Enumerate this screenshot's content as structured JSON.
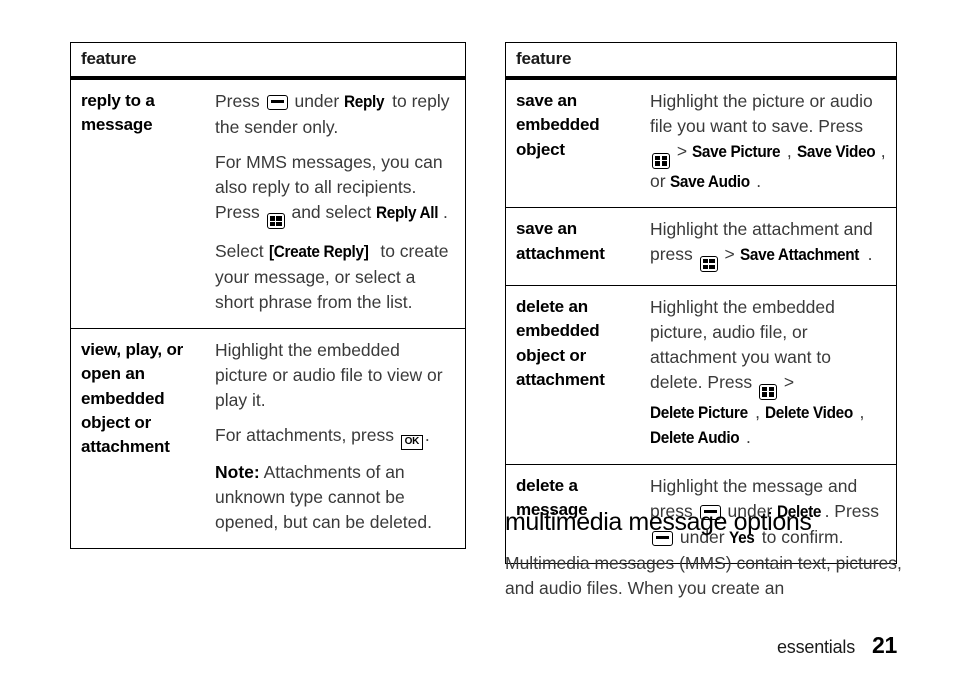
{
  "page": {
    "footer_chapter": "essentials",
    "footer_page_number": "21"
  },
  "left_table": {
    "header": "feature",
    "rows": [
      {
        "term": "reply to a message",
        "paragraphs": [
          [
            {
              "t": "text",
              "v": "Press "
            },
            {
              "t": "icon",
              "v": "softkey-icon"
            },
            {
              "t": "text",
              "v": " under "
            },
            {
              "t": "ui",
              "v": "Reply"
            },
            {
              "t": "text",
              "v": " to reply the sender only."
            }
          ],
          [
            {
              "t": "text",
              "v": "For MMS messages, you can also reply to all recipients. Press "
            },
            {
              "t": "icon",
              "v": "menu-key-icon"
            },
            {
              "t": "text",
              "v": " and select "
            },
            {
              "t": "ui",
              "v": "Reply All"
            },
            {
              "t": "text",
              "v": "."
            }
          ],
          [
            {
              "t": "text",
              "v": "Select "
            },
            {
              "t": "ui",
              "v": "[Create Reply]"
            },
            {
              "t": "text",
              "v": " to create your message, or select a short phrase from the list."
            }
          ]
        ]
      },
      {
        "term": "view, play, or open an embedded object or attachment",
        "paragraphs": [
          [
            {
              "t": "text",
              "v": "Highlight the embedded picture or audio file to view or play it."
            }
          ],
          [
            {
              "t": "text",
              "v": "For attachments, press "
            },
            {
              "t": "icon",
              "v": "ok-key-icon"
            },
            {
              "t": "text",
              "v": "."
            }
          ],
          [
            {
              "t": "lead",
              "v": "Note:"
            },
            {
              "t": "text",
              "v": " Attachments of an unknown type cannot be opened, but can be deleted."
            }
          ]
        ]
      }
    ]
  },
  "right_table": {
    "header": "feature",
    "rows": [
      {
        "term": "save an embedded object",
        "paragraphs": [
          [
            {
              "t": "text",
              "v": "Highlight the picture or audio file you want to save. Press "
            },
            {
              "t": "icon",
              "v": "menu-key-icon"
            },
            {
              "t": "text",
              "v": " > "
            },
            {
              "t": "ui",
              "v": "Save Picture"
            },
            {
              "t": "text",
              "v": ", "
            },
            {
              "t": "ui",
              "v": "Save Video"
            },
            {
              "t": "text",
              "v": ", or "
            },
            {
              "t": "ui",
              "v": "Save Audio"
            },
            {
              "t": "text",
              "v": "."
            }
          ]
        ]
      },
      {
        "term": "save an attachment",
        "paragraphs": [
          [
            {
              "t": "text",
              "v": "Highlight the attachment and press "
            },
            {
              "t": "icon",
              "v": "menu-key-icon"
            },
            {
              "t": "text",
              "v": " > "
            },
            {
              "t": "ui",
              "v": "Save Attachment"
            },
            {
              "t": "text",
              "v": "."
            }
          ]
        ]
      },
      {
        "term": "delete an embedded object or attachment",
        "paragraphs": [
          [
            {
              "t": "text",
              "v": "Highlight the embedded picture, audio file, or attachment you want to delete. Press "
            },
            {
              "t": "icon",
              "v": "menu-key-icon"
            },
            {
              "t": "text",
              "v": " > "
            },
            {
              "t": "ui",
              "v": "Delete Picture"
            },
            {
              "t": "text",
              "v": ", "
            },
            {
              "t": "ui",
              "v": "Delete Video"
            },
            {
              "t": "text",
              "v": ", "
            },
            {
              "t": "ui",
              "v": "Delete Audio"
            },
            {
              "t": "text",
              "v": "."
            }
          ]
        ]
      },
      {
        "term": "delete a message",
        "paragraphs": [
          [
            {
              "t": "text",
              "v": "Highlight the message and press "
            },
            {
              "t": "icon",
              "v": "softkey-icon"
            },
            {
              "t": "text",
              "v": " under "
            },
            {
              "t": "ui",
              "v": "Delete"
            },
            {
              "t": "text",
              "v": ". Press "
            },
            {
              "t": "icon",
              "v": "softkey-icon"
            },
            {
              "t": "text",
              "v": " under "
            },
            {
              "t": "ui",
              "v": "Yes"
            },
            {
              "t": "text",
              "v": " to confirm."
            }
          ]
        ]
      }
    ]
  },
  "section": {
    "heading": "multimedia message options",
    "body": "Multimedia messages (MMS) contain text, pictures, and audio files. When you create an"
  },
  "icons": {
    "ok_label": "OK"
  }
}
